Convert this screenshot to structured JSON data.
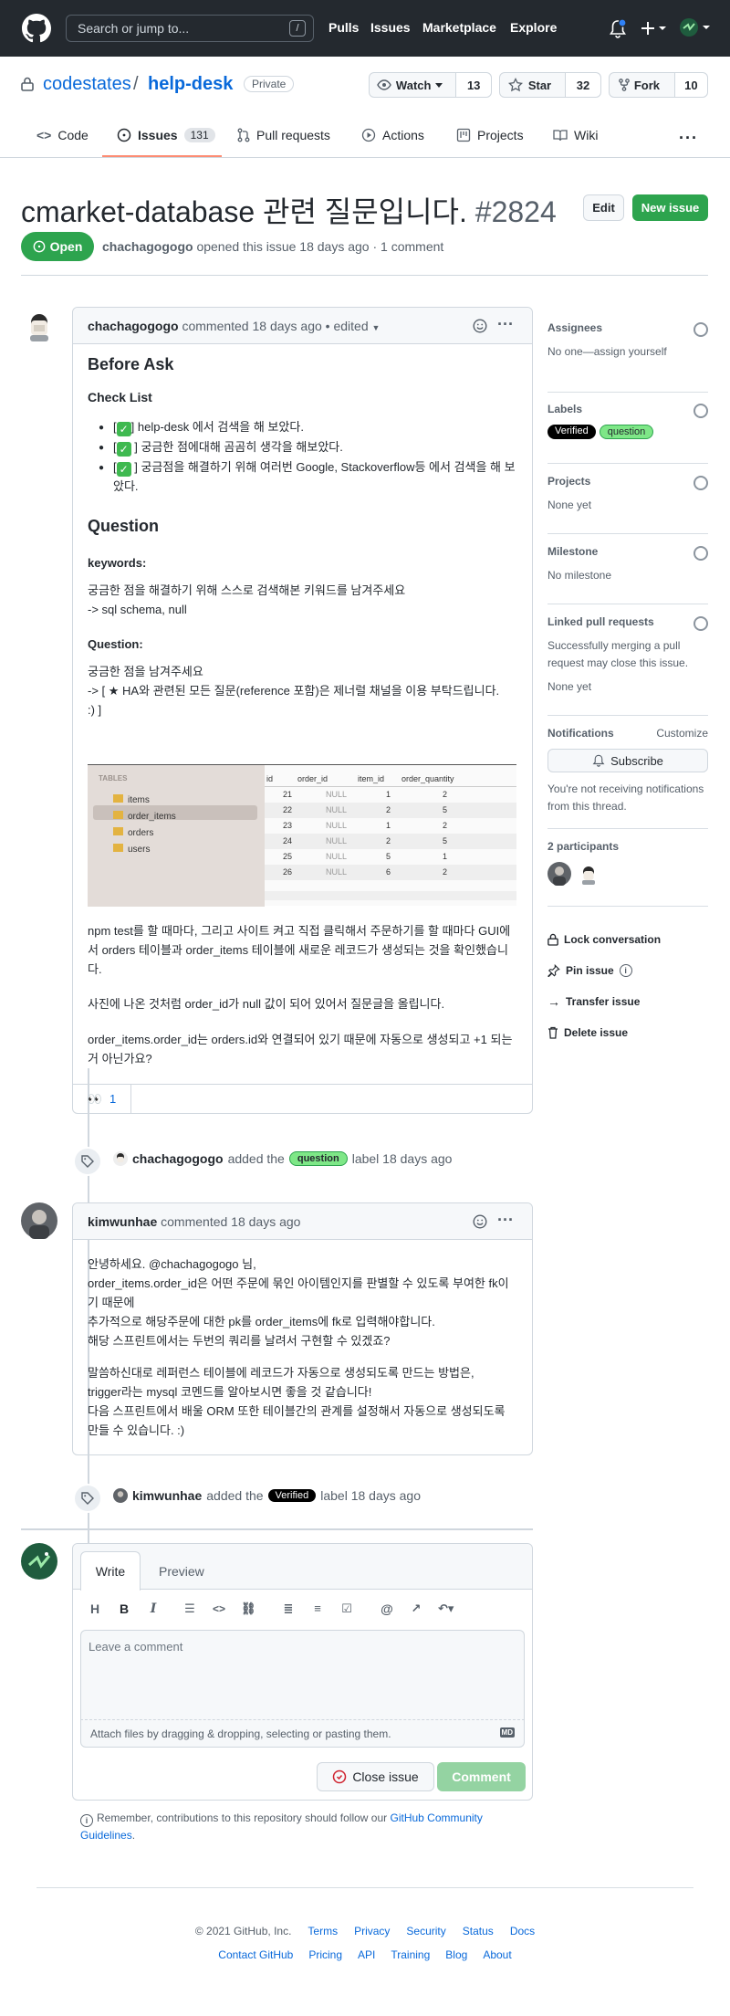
{
  "header": {
    "search_placeholder": "Search or jump to...",
    "search_key": "/",
    "nav": [
      "Pulls",
      "Issues",
      "Marketplace",
      "Explore"
    ]
  },
  "repo": {
    "owner": "codestates",
    "sep": "/",
    "name": "help-desk",
    "visibility": "Private",
    "watch_label": "Watch",
    "watch_count": "13",
    "star_label": "Star",
    "star_count": "32",
    "fork_label": "Fork",
    "fork_count": "10"
  },
  "tabs": {
    "code": "Code",
    "issues": "Issues",
    "issues_count": "131",
    "pulls": "Pull requests",
    "actions": "Actions",
    "projects": "Projects",
    "wiki": "Wiki"
  },
  "issue": {
    "title": "cmarket-database 관련 질문입니다.",
    "number": "#2824",
    "edit": "Edit",
    "new_issue": "New issue",
    "status": "Open",
    "author": "chachagogogo",
    "meta": "opened this issue 18 days ago · 1 comment"
  },
  "comment1": {
    "author": "chachagogogo",
    "meta": "commented 18 days ago",
    "edited": "• edited",
    "h_before": "Before Ask",
    "h_checklist": "Check List",
    "checks": [
      "help-desk 에서 검색을 해 보았다.",
      "궁금한 점에대해 곰곰히 생각을 해보았다.",
      "궁금점을 해결하기 위해 여러번 Google, Stackoverflow등 에서 검색을 해 보았다."
    ],
    "h_question": "Question",
    "h_keywords": "keywords:",
    "kw_line1": "궁금한 점을 해결하기 위해 스스로 검색해본 키워드를 남겨주세요",
    "kw_line2": "-> sql schema, null",
    "h_question2": "Question:",
    "q_line1": "궁금한 점을 남겨주세요",
    "q_line2": "-> [ ★ HA와 관련된 모든 질문(reference 포함)은 제너럴 채널을 이용 부탁드립니다.",
    "q_line3": ":) ]",
    "p1": "npm test를 할 때마다, 그리고 사이트 켜고 직접 클릭해서 주문하기를 할 때마다 GUI에서 orders 테이블과 order_items 테이블에 새로운 레코드가 생성되는 것을 확인했습니다.",
    "p2": "사진에 나온 것처럼 order_id가 null 값이 되어 있어서 질문글을 올립니다.",
    "p3": "order_items.order_id는 orders.id와 연결되어 있기 때문에 자동으로 생성되고 +1 되는 거 아닌가요?",
    "reaction": "👀",
    "reaction_count": "1"
  },
  "db_shot": {
    "tables_header": "TABLES",
    "tables": [
      "items",
      "order_items",
      "orders",
      "users"
    ],
    "columns": [
      "id",
      "order_id",
      "item_id",
      "order_quantity"
    ],
    "rows": [
      [
        "21",
        "NULL",
        "1",
        "2"
      ],
      [
        "22",
        "NULL",
        "2",
        "5"
      ],
      [
        "23",
        "NULL",
        "1",
        "2"
      ],
      [
        "24",
        "NULL",
        "2",
        "5"
      ],
      [
        "25",
        "NULL",
        "5",
        "1"
      ],
      [
        "26",
        "NULL",
        "6",
        "2"
      ]
    ]
  },
  "event1": {
    "author": "chachagogogo",
    "text": "added the",
    "label": "question",
    "tail": "label 18 days ago"
  },
  "comment2": {
    "author": "kimwunhae",
    "meta": "commented 18 days ago",
    "l1": "안녕하세요. @chachagogogo 님,",
    "l2": "order_items.order_id은 어떤 주문에 묶인 아이템인지를 판별할 수 있도록 부여한 fk이기 때문에",
    "l3": "추가적으로 해당주문에 대한 pk를 order_items에 fk로 입력해야합니다.",
    "l4": "해당 스프린트에서는 두번의 쿼리를 날려서 구현할 수 있겠죠?",
    "l5": "말씀하신대로 레퍼런스 테이블에 레코드가 자동으로 생성되도록 만드는 방법은,",
    "l6": "trigger라는 mysql 코멘드를 알아보시면 좋을 것 같습니다!",
    "l7": "다음 스프린트에서 배울 ORM 또한 테이블간의 관계를 설정해서 자동으로 생성되도록 만들 수 있습니다. :)"
  },
  "event2": {
    "author": "kimwunhae",
    "text": "added the",
    "label": "Verified",
    "tail": "label 18 days ago"
  },
  "editor": {
    "write": "Write",
    "preview": "Preview",
    "placeholder": "Leave a comment",
    "attach": "Attach files by dragging & dropping, selecting or pasting them.",
    "md": "MD",
    "close": "Close issue",
    "comment": "Comment",
    "guidelines_pre": "Remember, contributions to this repository should follow our",
    "guidelines_link": "GitHub Community Guidelines",
    "guidelines_post": "."
  },
  "sidebar": {
    "assignees": "Assignees",
    "assignees_v": "No one—assign yourself",
    "labels": "Labels",
    "label_verified": "Verified",
    "label_question": "question",
    "projects": "Projects",
    "projects_v": "None yet",
    "milestone": "Milestone",
    "milestone_v": "No milestone",
    "linked": "Linked pull requests",
    "linked_v": "Successfully merging a pull request may close this issue.",
    "linked_v2": "None yet",
    "notifications": "Notifications",
    "customize": "Customize",
    "subscribe": "Subscribe",
    "notif_v": "You're not receiving notifications from this thread.",
    "participants": "2 participants",
    "lock": "Lock conversation",
    "pin": "Pin issue",
    "transfer": "Transfer issue",
    "delete": "Delete issue"
  },
  "footer": {
    "copy": "© 2021 GitHub, Inc.",
    "links1": [
      "Terms",
      "Privacy",
      "Security",
      "Status",
      "Docs"
    ],
    "links2": [
      "Contact GitHub",
      "Pricing",
      "API",
      "Training",
      "Blog",
      "About"
    ]
  },
  "colors": {
    "header_bg": "#24292f",
    "green": "#2da44e",
    "link": "#0969da",
    "label_question": "#7ee787",
    "label_verified": "#000000"
  }
}
